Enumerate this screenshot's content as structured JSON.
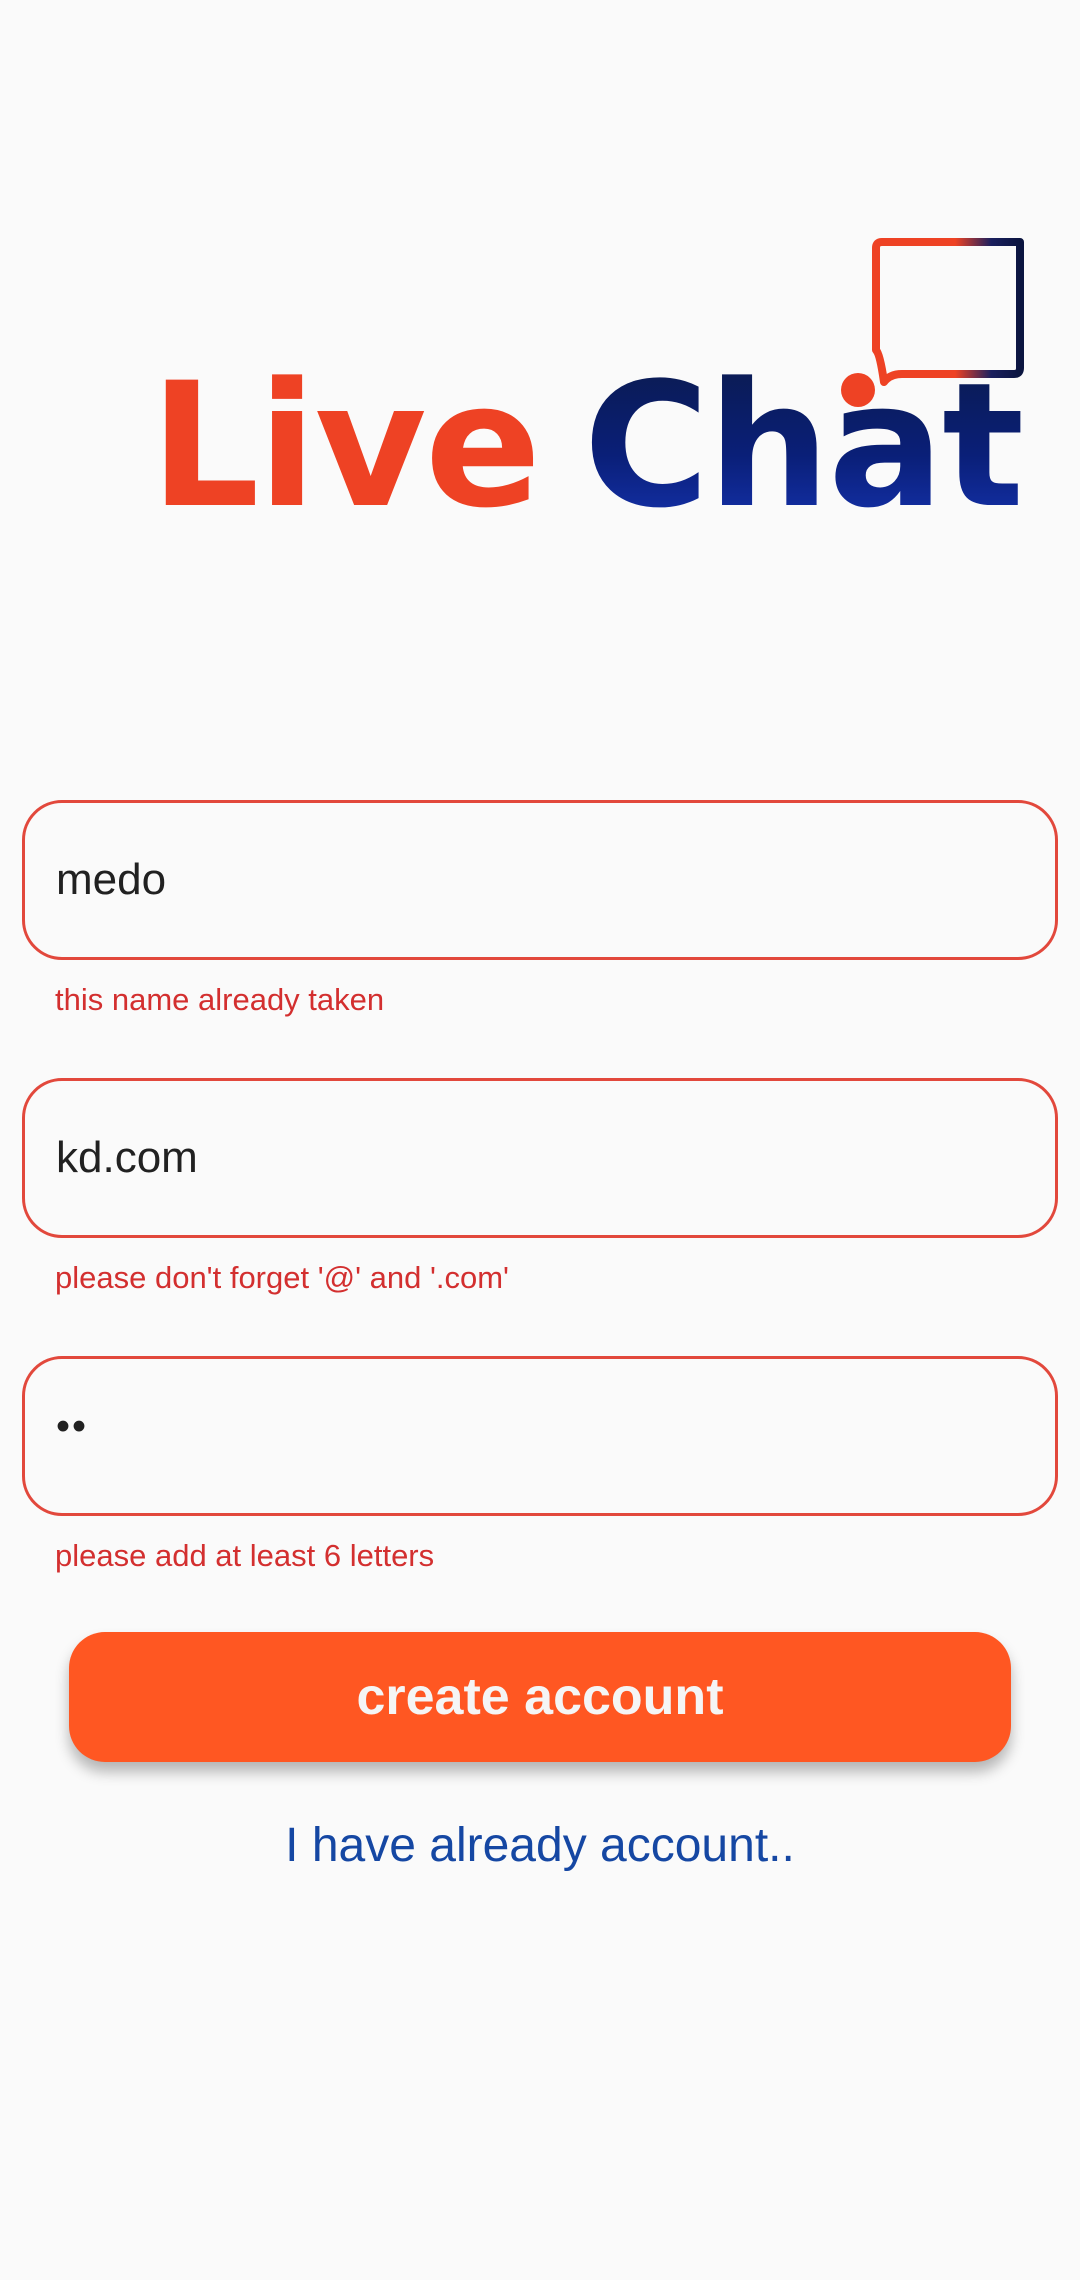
{
  "logo": {
    "word_1": "Live",
    "word_2": "Chat",
    "icon": "chat-bubble-icon",
    "colors": {
      "live": "#ee4224",
      "chat": "#0a1f78"
    }
  },
  "form": {
    "name_field": {
      "value": "medo",
      "error": "this name already taken"
    },
    "email_field": {
      "value": "kd.com",
      "error": "please don't forget '@' and '.com'"
    },
    "password_field": {
      "masked_value": "••",
      "error": "please add at least 6 letters"
    }
  },
  "actions": {
    "create_label": "create account",
    "login_link": "I have already account.."
  },
  "colors": {
    "accent": "#ff5722",
    "error": "#d32f2f",
    "field_border": "#e2483c",
    "link": "#1547a3",
    "background": "#fafafa"
  }
}
